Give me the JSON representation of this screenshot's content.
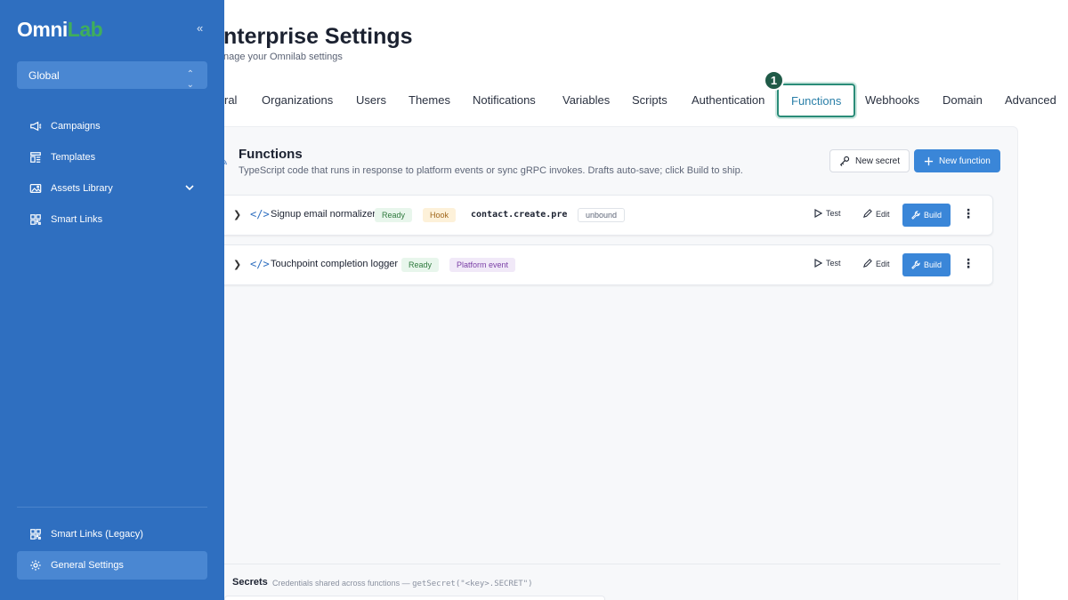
{
  "brand": {
    "logo_part1": "Omni",
    "logo_part2": "Lab"
  },
  "sidebar": {
    "collapse_glyph": "«",
    "scope_select": "Global",
    "items": [
      {
        "label": "Campaigns",
        "icon": "megaphone-icon"
      },
      {
        "label": "Templates",
        "icon": "template-icon"
      },
      {
        "label": "Assets Library",
        "icon": "image-icon"
      },
      {
        "label": "Smart Links",
        "icon": "qr-icon"
      }
    ],
    "bottom_items": [
      {
        "label": "Smart Links (Legacy)",
        "icon": "qr-icon"
      },
      {
        "label": "General Settings",
        "icon": "gear-icon",
        "active": true
      }
    ]
  },
  "header": {
    "title": "nterprise Settings",
    "subtitle": "nage your Omnilab settings"
  },
  "tabs": [
    {
      "label": "ral"
    },
    {
      "label": "Organizations"
    },
    {
      "label": "Users"
    },
    {
      "label": "Themes"
    },
    {
      "label": "Notifications"
    },
    {
      "label": "Variables"
    },
    {
      "label": "Scripts"
    },
    {
      "label": "Authentication"
    },
    {
      "label": "Functions",
      "active": true
    },
    {
      "label": "Webhooks"
    },
    {
      "label": "Domain"
    },
    {
      "label": "Advanced"
    }
  ],
  "step_badge": "1",
  "functions": {
    "title": "Functions",
    "description": "TypeScript code that runs in response to platform events or sync gRPC invokes. Drafts auto-save; click Build to ship.",
    "new_secret_label": "New secret",
    "new_function_label": "New function",
    "rows": [
      {
        "name": "Signup email normalizer",
        "status": "Ready",
        "kind": "Hook",
        "event": "contact.create.pre",
        "binding": "unbound"
      },
      {
        "name": "Touchpoint completion logger",
        "status": "Ready",
        "kind": "Platform event"
      }
    ],
    "actions": {
      "test": "Test",
      "edit": "Edit",
      "build": "Build",
      "more": "⋮"
    }
  },
  "secrets": {
    "title": "Secrets",
    "description": "Credentials shared across functions — ",
    "code": "getSecret(\"<key>.SECRET\")"
  },
  "colors": {
    "sidebar_bg": "#2f6fc0",
    "accent": "#3a86d8",
    "active_tab_border": "#2a8c78",
    "logo_green": "#3fae5c"
  }
}
